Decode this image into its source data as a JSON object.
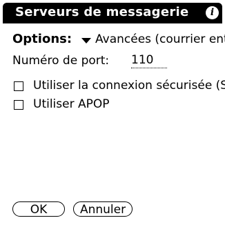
{
  "window": {
    "title": "Serveurs de messagerie",
    "info_icon": "info-icon"
  },
  "options": {
    "label": "Options:",
    "selected_value": "Avancées (courrier ent",
    "trigger_icon": "triangle-down-icon"
  },
  "port": {
    "label": "Numéro de port:",
    "value": "110"
  },
  "checkboxes": [
    {
      "label": "Utiliser la connexion sécurisée (S",
      "checked": false
    },
    {
      "label": "Utiliser APOP",
      "checked": false
    }
  ],
  "buttons": {
    "ok_label": "OK",
    "cancel_label": "Annuler"
  }
}
